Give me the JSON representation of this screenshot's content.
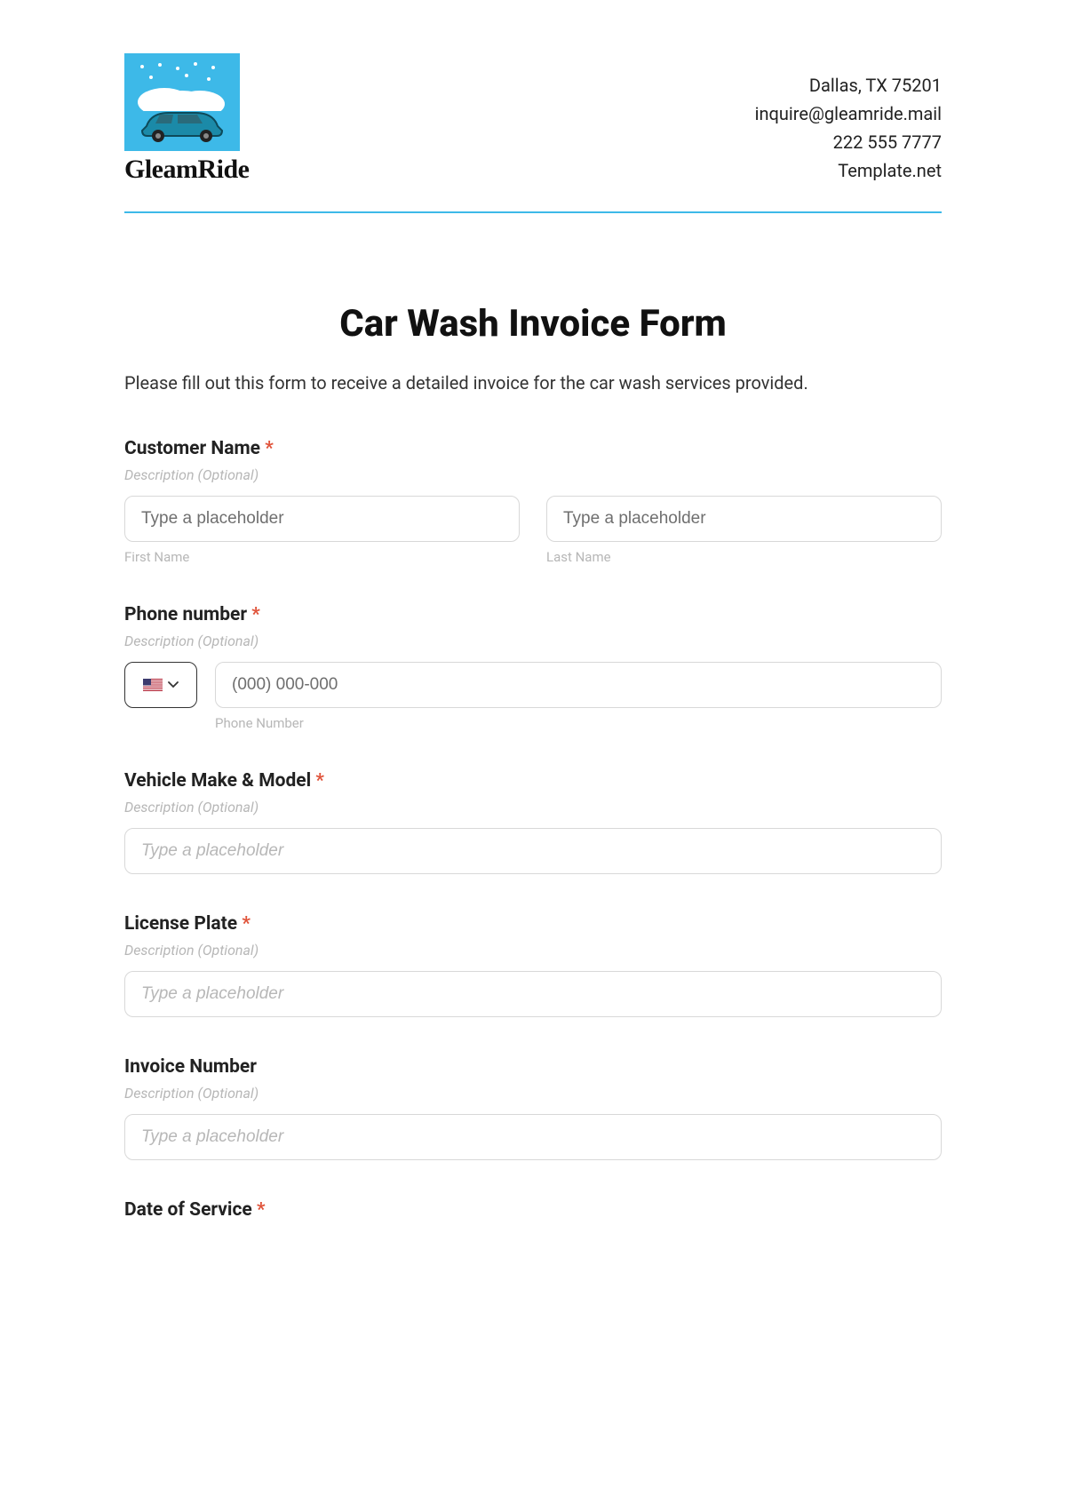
{
  "header": {
    "brand": "GleamRide",
    "contact": {
      "address": "Dallas, TX 75201",
      "email": "inquire@gleamride.mail",
      "phone": "222 555 7777",
      "site": "Template.net"
    }
  },
  "form": {
    "title": "Car Wash Invoice Form",
    "subtitle": "Please fill out this form to receive a detailed invoice for the car wash services provided.",
    "desc_placeholder": "Description (Optional)",
    "customer_name": {
      "label": "Customer Name",
      "required": "*",
      "first_ph": "Type a placeholder",
      "first_sub": "First Name",
      "last_ph": "Type a placeholder",
      "last_sub": "Last Name"
    },
    "phone": {
      "label": "Phone number",
      "required": "*",
      "placeholder": "(000) 000-000",
      "sub": "Phone Number"
    },
    "vehicle": {
      "label": "Vehicle Make & Model",
      "required": "*",
      "placeholder": "Type a placeholder"
    },
    "license": {
      "label": "License Plate",
      "required": "*",
      "placeholder": "Type a placeholder"
    },
    "invoice_number": {
      "label": "Invoice Number",
      "placeholder": "Type a placeholder"
    },
    "date_of_service": {
      "label": "Date of Service",
      "required": "*"
    }
  }
}
